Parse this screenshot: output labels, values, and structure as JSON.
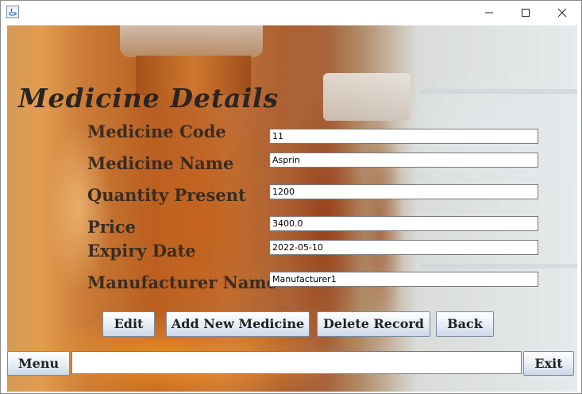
{
  "window": {
    "controls": {
      "minimize_icon": "minimize-icon",
      "maximize_icon": "maximize-icon",
      "close_icon": "close-icon"
    }
  },
  "form": {
    "title": "Medicine Details",
    "fields": [
      {
        "label": "Medicine Code",
        "value": "11"
      },
      {
        "label": "Medicine Name",
        "value": "Asprin"
      },
      {
        "label": "Quantity Present",
        "value": "1200"
      },
      {
        "label": "Price",
        "value": "3400.0"
      },
      {
        "label": "Expiry Date",
        "value": "2022-05-10"
      },
      {
        "label": "Manufacturer Name",
        "value": "Manufacturer1"
      }
    ]
  },
  "actions": {
    "edit_label": "Edit",
    "add_label": "Add New Medicine",
    "delete_label": "Delete Record",
    "back_label": "Back"
  },
  "footer": {
    "menu_label": "Menu",
    "status_value": "",
    "exit_label": "Exit"
  }
}
